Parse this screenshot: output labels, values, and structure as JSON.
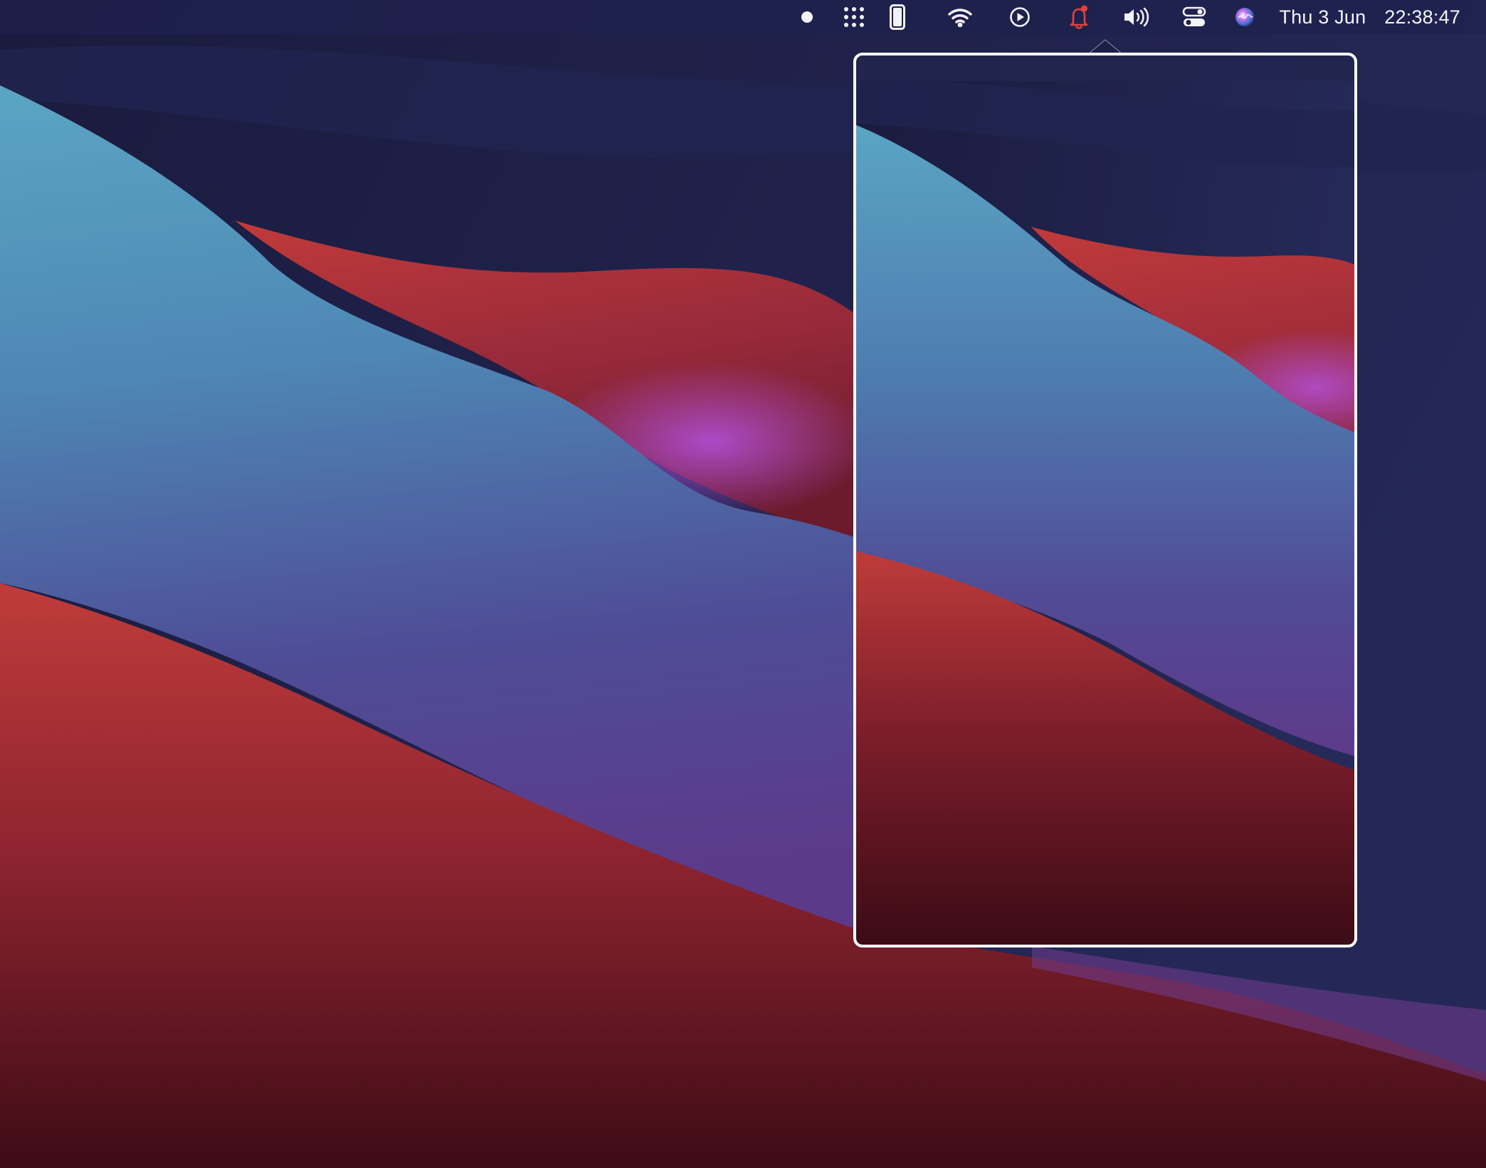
{
  "menubar": {
    "status_icons": [
      "record-dot-icon",
      "grid-dots-icon",
      "phone-icon",
      "wifi-icon",
      "play-circle-icon",
      "notification-bell-icon",
      "volume-icon",
      "control-center-icon",
      "siri-icon"
    ],
    "date": "Thu 3 Jun",
    "time": "22:38:47"
  },
  "colors": {
    "menubar_text": "#f2f2f7",
    "bell_accent": "#e0443a",
    "popover_border": "#ffffff"
  }
}
